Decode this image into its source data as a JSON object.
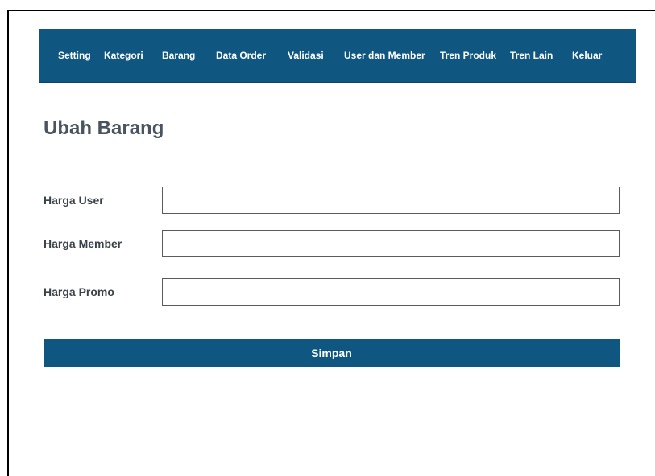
{
  "nav": {
    "items": [
      {
        "label": "Setting"
      },
      {
        "label": "Kategori"
      },
      {
        "label": "Barang"
      },
      {
        "label": "Data Order"
      },
      {
        "label": "Validasi"
      },
      {
        "label": "User dan Member"
      },
      {
        "label": "Tren Produk"
      },
      {
        "label": "Tren Lain"
      },
      {
        "label": "Keluar"
      }
    ]
  },
  "page": {
    "title": "Ubah Barang"
  },
  "form": {
    "fields": [
      {
        "label": "Harga User",
        "value": "",
        "placeholder": ""
      },
      {
        "label": "Harga Member",
        "value": "",
        "placeholder": ""
      },
      {
        "label": "Harga Promo",
        "value": "",
        "placeholder": ""
      }
    ],
    "submit_label": "Simpan"
  },
  "colors": {
    "primary": "#0f5680",
    "title": "#4a5460",
    "label": "#3b4148"
  }
}
